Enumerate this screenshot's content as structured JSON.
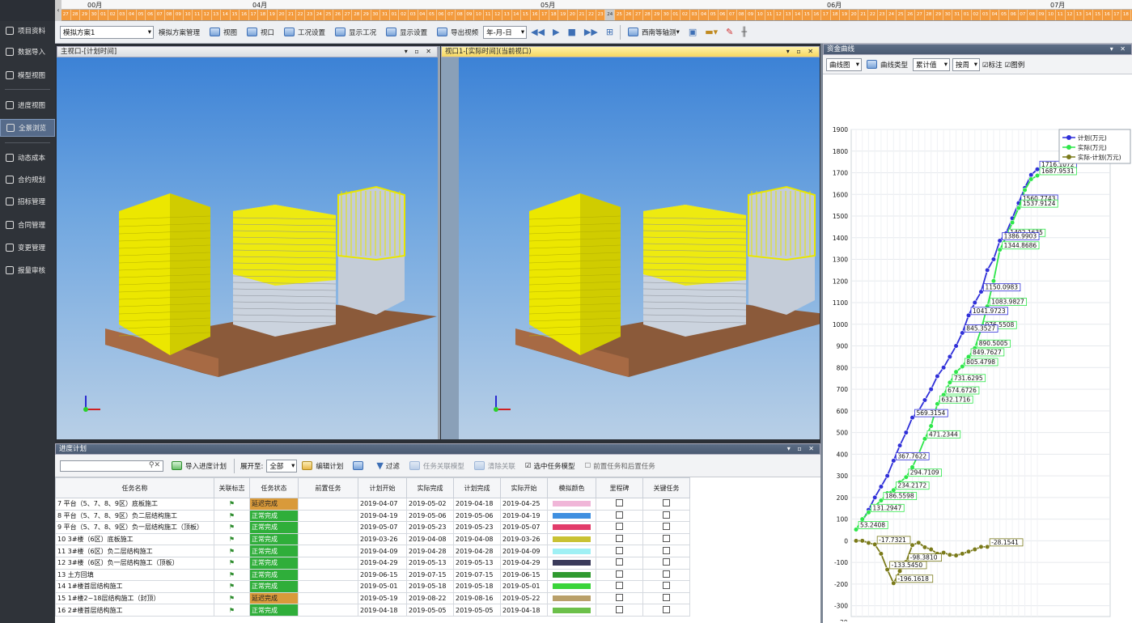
{
  "timeline": {
    "months": [
      {
        "label": "00月",
        "left": 32
      },
      {
        "label": "04月",
        "left": 236
      },
      {
        "label": "05月",
        "left": 592
      },
      {
        "label": "06月",
        "left": 946
      },
      {
        "label": "07月",
        "left": 1222
      }
    ],
    "days_text": "27 28 29 30 01 02 03 04 05 06 07 08 09 10 11 12 13 14 15 16 17 18 19 20 21 22 23 24 25 26 27 28 29 30 31 01 02 03 04 05 06 07 08 09 10 11 12 13 14 15 16 17 18 19 20 21 22 23 24 25 26 27 28 29 30 01 02 03 04 05 06 07 08 09 10 11 12 13 14 15 16 17 18 19 20 21 22 23 24 25 26 27 28 29 30 31 01 02 03 04 05 06 07 08 09 10 11 12 13 14 15 16 17 18 19 20 21 22 23 24 25 26 27 28 29 30 01 02 03 04 05 06 07 08 09 10 11 12 13 14 15 16"
  },
  "sidebar": {
    "items": [
      "项目资料",
      "数据导入",
      "模型视图",
      "进度视图",
      "全景浏览",
      "动态成本",
      "合约规划",
      "招标管理",
      "合同管理",
      "变更管理",
      "报量审核"
    ],
    "active": 4
  },
  "toolbar": {
    "scheme": "模拟方案1",
    "scheme_mgr": "模拟方案管理",
    "view": "视图",
    "viewport": "视口",
    "work_settings": "工况设置",
    "show_work": "显示工况",
    "display_settings": "显示设置",
    "export_video": "导出视频",
    "date_format": "年-月-日",
    "angle": "西南等轴测"
  },
  "viewports": {
    "left_title": "主视口-[计划时间]",
    "right_title": "视口1-[实际时间](当前视口)",
    "ctrls": "▾ ▫ ✕"
  },
  "schedule": {
    "title": "进度计划",
    "import": "导入进度计划",
    "expand_label": "展开至:",
    "expand_value": "全部",
    "edit": "编辑计划",
    "filter": "过滤",
    "link_model": "任务关联模型",
    "unlink": "清除关联",
    "select_model": "选中任务模型",
    "pre_post": "前置任务和后置任务",
    "columns": [
      "任务名称",
      "关联标志",
      "任务状态",
      "前置任务",
      "计划开始",
      "实际完成",
      "计划完成",
      "实际开始",
      "模拟颜色",
      "里程碑",
      "关键任务"
    ],
    "rows": [
      {
        "no": "7",
        "name": "平台（5、7、8、9区）底板施工",
        "status": "延迟完成",
        "s": "late",
        "ps": "2019-04-07",
        "af": "2019-05-02",
        "pf": "2019-04-18",
        "as": "2019-04-25",
        "color": "#f0b6d8"
      },
      {
        "no": "8",
        "name": "平台（5、7、8、9区）负二层结构施工",
        "status": "正常完成",
        "s": "ok",
        "ps": "2019-04-19",
        "af": "2019-05-06",
        "pf": "2019-05-06",
        "as": "2019-04-19",
        "color": "#3f8fe0"
      },
      {
        "no": "9",
        "name": "平台（5、7、8、9区）负一层结构施工（顶板）",
        "status": "正常完成",
        "s": "ok",
        "ps": "2019-05-07",
        "af": "2019-05-23",
        "pf": "2019-05-23",
        "as": "2019-05-07",
        "color": "#e23c6a"
      },
      {
        "no": "10",
        "name": "3#楼（6区）底板施工",
        "status": "正常完成",
        "s": "ok",
        "ps": "2019-03-26",
        "af": "2019-04-08",
        "pf": "2019-04-08",
        "as": "2019-03-26",
        "color": "#c9c233"
      },
      {
        "no": "11",
        "name": "3#楼（6区）负二层结构施工",
        "status": "正常完成",
        "s": "ok",
        "ps": "2019-04-09",
        "af": "2019-04-28",
        "pf": "2019-04-28",
        "as": "2019-04-09",
        "color": "#9ff0f4"
      },
      {
        "no": "12",
        "name": "3#楼（6区）负一层结构施工（顶板）",
        "status": "正常完成",
        "s": "ok",
        "ps": "2019-04-29",
        "af": "2019-05-13",
        "pf": "2019-05-13",
        "as": "2019-04-29",
        "color": "#3a3a5a"
      },
      {
        "no": "13",
        "name": "土方回填",
        "status": "正常完成",
        "s": "ok",
        "ps": "2019-06-15",
        "af": "2019-07-15",
        "pf": "2019-07-15",
        "as": "2019-06-15",
        "color": "#2f9a2f"
      },
      {
        "no": "14",
        "name": "1#楼首层结构施工",
        "status": "正常完成",
        "s": "ok",
        "ps": "2019-05-01",
        "af": "2019-05-18",
        "pf": "2019-05-18",
        "as": "2019-05-01",
        "color": "#3ad43a"
      },
      {
        "no": "15",
        "name": "1#楼2~18层结构施工（封顶）",
        "status": "延迟完成",
        "s": "late",
        "ps": "2019-05-19",
        "af": "2019-08-22",
        "pf": "2019-08-16",
        "as": "2019-05-22",
        "color": "#b9a06a"
      },
      {
        "no": "16",
        "name": "2#楼首层结构施工",
        "status": "正常完成",
        "s": "ok",
        "ps": "2019-04-18",
        "af": "2019-05-05",
        "pf": "2019-05-05",
        "as": "2019-04-18",
        "color": "#6cc04a"
      }
    ]
  },
  "curve": {
    "title": "资金曲线",
    "type_sel": "曲线图",
    "curve_type": "曲线类型",
    "cum": "累计值",
    "period": "按周",
    "label_chk": "标注",
    "legend_chk": "图例",
    "ctrls": "▾ ✕"
  },
  "chart_data": {
    "type": "line",
    "ylim": [
      -350,
      1900
    ],
    "yticks": [
      -300,
      -200,
      -100,
      0,
      100,
      200,
      300,
      400,
      500,
      600,
      700,
      800,
      900,
      1000,
      1100,
      1200,
      1300,
      1400,
      1500,
      1600,
      1700,
      1800,
      1900
    ],
    "legend_position": "top-right",
    "grid": true,
    "series": [
      {
        "name": "计划(万元)",
        "color": "#2f2fd8",
        "values": [
          52,
          90,
          143,
          200,
          250,
          300,
          370,
          440,
          500,
          569,
          600,
          650,
          700,
          760,
          800,
          850,
          900,
          960,
          1041,
          1100,
          1150,
          1250,
          1300,
          1386,
          1420,
          1490,
          1560,
          1630,
          1690,
          1716
        ]
      },
      {
        "name": "实际(万元)",
        "color": "#2ee64a",
        "values": [
          52,
          100,
          131,
          160,
          186,
          220,
          234,
          270,
          294,
          340,
          400,
          471,
          530,
          632,
          674,
          731,
          780,
          805,
          850,
          890,
          976,
          1083,
          1200,
          1344,
          1402,
          1470,
          1537,
          1620,
          1670,
          1687
        ]
      },
      {
        "name": "实际-计划(万元)",
        "color": "#7a7a1a",
        "values": [
          0,
          0,
          -10,
          -17,
          -60,
          -133,
          -196,
          -140,
          -98,
          -20,
          -9,
          -30,
          -40,
          -60,
          -55,
          -65,
          -68,
          -60,
          -50,
          -40,
          -28,
          -28
        ]
      }
    ],
    "labels": [
      {
        "text": "1716.1072",
        "i": 29,
        "s": 0
      },
      {
        "text": "1687.9531",
        "i": 29,
        "s": 1
      },
      {
        "text": "1560.7743",
        "i": 26,
        "s": 0
      },
      {
        "text": "1537.9124",
        "i": 26,
        "s": 1
      },
      {
        "text": "1402.1635",
        "i": 24,
        "s": 1
      },
      {
        "text": "1386.9903",
        "i": 23,
        "s": 0
      },
      {
        "text": "1344.8686",
        "i": 23,
        "s": 1
      },
      {
        "text": "1150.0983",
        "i": 20,
        "s": 0
      },
      {
        "text": "1083.9827",
        "i": 21,
        "s": 1
      },
      {
        "text": "1041.9723",
        "i": 18,
        "s": 0
      },
      {
        "text": "976.5508",
        "i": 20,
        "s": 1
      },
      {
        "text": "845.3527",
        "i": 17,
        "s": 0
      },
      {
        "text": "890.5005",
        "i": 19,
        "s": 1
      },
      {
        "text": "849.7627",
        "i": 18,
        "s": 1
      },
      {
        "text": "805.4798",
        "i": 17,
        "s": 1
      },
      {
        "text": "731.6295",
        "i": 15,
        "s": 1
      },
      {
        "text": "674.6726",
        "i": 14,
        "s": 1
      },
      {
        "text": "632.1716",
        "i": 13,
        "s": 1
      },
      {
        "text": "569.3154",
        "i": 9,
        "s": 0
      },
      {
        "text": "471.2344",
        "i": 11,
        "s": 1
      },
      {
        "text": "367.7622",
        "i": 6,
        "s": 0
      },
      {
        "text": "294.7109",
        "i": 8,
        "s": 1
      },
      {
        "text": "234.2172",
        "i": 6,
        "s": 1
      },
      {
        "text": "186.5598",
        "i": 4,
        "s": 1
      },
      {
        "text": "131.2947",
        "i": 2,
        "s": 1
      },
      {
        "text": "53.2408",
        "i": 0,
        "s": 1
      },
      {
        "text": "-17.7321",
        "i": 3,
        "s": 2
      },
      {
        "text": "-133.5450",
        "i": 5,
        "s": 2
      },
      {
        "text": "-196.1618",
        "i": 6,
        "s": 2
      },
      {
        "text": "-98.3810",
        "i": 8,
        "s": 2
      },
      {
        "text": "-28.1541",
        "i": 21,
        "s": 2
      }
    ],
    "xlabel_hint": "20"
  }
}
